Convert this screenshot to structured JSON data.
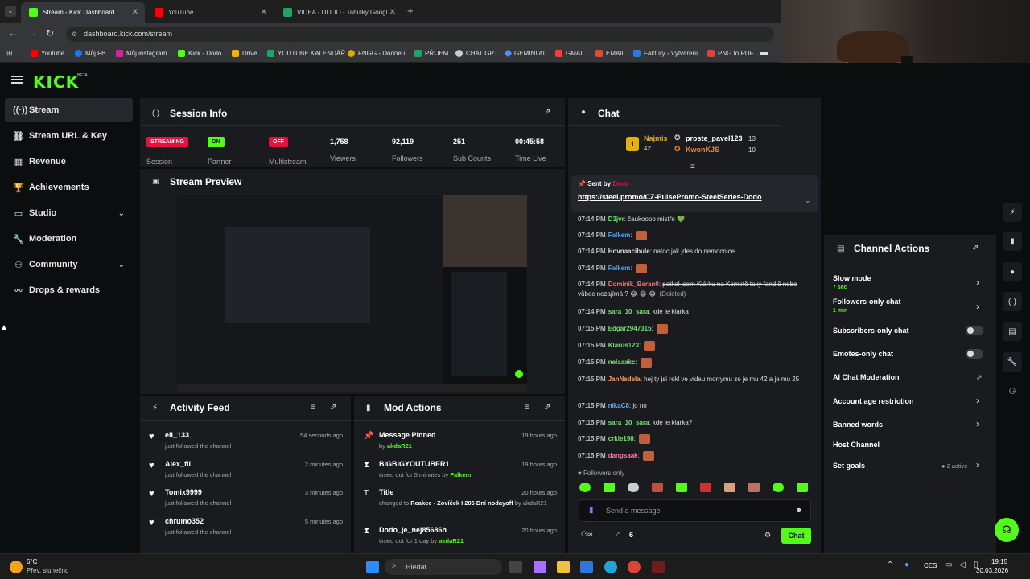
{
  "browser": {
    "tabs": [
      {
        "label": "Stream - Kick Dashboard",
        "color": "#53fc18"
      },
      {
        "label": "YouTube",
        "color": "#ff0000"
      },
      {
        "label": "VIDEA - DODO - Tabulky Googl...",
        "color": "#1fa463"
      }
    ],
    "url": "dashboard.kick.com/stream",
    "bookmarks": [
      {
        "label": "Youtube",
        "color": "#ff0000"
      },
      {
        "label": "Můj FB",
        "color": "#1877f2"
      },
      {
        "label": "Můj instagram",
        "color": "#d6249f"
      },
      {
        "label": "Kick - Dodo",
        "color": "#53fc18"
      },
      {
        "label": "Drive",
        "color": "#f4b400"
      },
      {
        "label": "YOUTUBE KALENDÁŘ",
        "color": "#1fa463"
      },
      {
        "label": "FNGG - Dodoeu",
        "color": "#e0a800"
      },
      {
        "label": "PŘÍJEM",
        "color": "#1fa463"
      },
      {
        "label": "CHAT GPT",
        "color": "#cccccc"
      },
      {
        "label": "GEMINI AI",
        "color": "#4f8cff"
      },
      {
        "label": "GMAIL",
        "color": "#ea4335"
      },
      {
        "label": "EMAIL",
        "color": "#e14b2c"
      },
      {
        "label": "Faktury - Vytváření",
        "color": "#2b79d8"
      },
      {
        "label": "PNG to PDF",
        "color": "#e0413a"
      }
    ]
  },
  "app": {
    "logo": "KICK",
    "logo_badge": "BETA",
    "sidebar": [
      {
        "label": "Stream",
        "icon": "radio-icon"
      },
      {
        "label": "Stream URL & Key",
        "icon": "link-icon"
      },
      {
        "label": "Revenue",
        "icon": "revenue-icon"
      },
      {
        "label": "Achievements",
        "icon": "trophy-icon"
      },
      {
        "label": "Studio",
        "icon": "studio-icon"
      },
      {
        "label": "Moderation",
        "icon": "wrench-icon"
      },
      {
        "label": "Community",
        "icon": "community-icon"
      },
      {
        "label": "Drops & rewards",
        "icon": "gift-icon"
      }
    ],
    "session": {
      "title": "Session Info",
      "streaming_badge": "STREAMING",
      "session_label": "Session",
      "partner_badge": "ON",
      "partner_label": "Partner",
      "multistream_badge": "OFF",
      "multistream_label": "Multistream",
      "viewers": "1,758",
      "viewers_label": "Viewers",
      "followers": "92,119",
      "followers_label": "Followers",
      "subs": "251",
      "subs_label": "Sub Counts",
      "time": "00:45:58",
      "time_label": "Time Live"
    },
    "preview": {
      "title": "Stream Preview"
    },
    "activity": {
      "title": "Activity Feed",
      "items": [
        {
          "name": "eli_133",
          "sub": "just followed the channel",
          "time": "54 seconds ago"
        },
        {
          "name": "Alex_fil",
          "sub": "just followed the channel",
          "time": "2 minutes ago"
        },
        {
          "name": "Tomix9999",
          "sub": "just followed the channel",
          "time": "3 minutes ago"
        },
        {
          "name": "chrumo352",
          "sub": "just followed the channel",
          "time": "5 minutes ago"
        }
      ]
    },
    "mod": {
      "title": "Mod Actions",
      "items": [
        {
          "name": "Message Pinned",
          "pre": "by",
          "who": "akdaR21",
          "post": "",
          "time": "19 hours ago"
        },
        {
          "name": "BIGBIGYOUTUBER1",
          "pre": "timed out for 5 minutes by",
          "who": "Falkem",
          "post": "",
          "time": "19 hours ago"
        },
        {
          "name": "Title",
          "pre": "changed to",
          "who": "Reakce - Zovíček I 205 Dní nodayoff",
          "post": "by akdaR21",
          "time": "20 hours ago"
        },
        {
          "name": "Dodo_je_nej85686h",
          "pre": "timed out for 1 day by",
          "who": "akdaR21",
          "post": "",
          "time": "20 hours ago"
        }
      ]
    },
    "chat": {
      "title": "Chat",
      "leader_1": "Najmis",
      "leader_1_count": "42",
      "leader_2": "proste_pavel123",
      "leader_2_count": "13",
      "leader_3": "KwonKJS",
      "leader_3_count": "10",
      "pinned_by": "Sent by",
      "pinned_user": "Dodo",
      "pinned_link": "https://steel.promo/CZ-PulsePromo-SteelSeries-Dodo",
      "messages": [
        {
          "time": "07:14 PM",
          "user": "D3jvr",
          "color": "#6fe36f",
          "text": "čaukoooo mistře 💚"
        },
        {
          "time": "07:14 PM",
          "user": "Falkem",
          "color": "#4aa8ff",
          "text": ""
        },
        {
          "time": "07:14 PM",
          "user": "Hovnaacibule",
          "color": "#dddddd",
          "text": "natoc jak jdes do nemocnice"
        },
        {
          "time": "07:14 PM",
          "user": "Falkem",
          "color": "#4aa8ff",
          "text": ""
        },
        {
          "time": "07:14 PM",
          "user": "Dominik_Beran0",
          "color": "#ff6b6b",
          "text": "potkal jsem Klárku na Kometě taky fandíš nebo vůbec nezajímá ? 😂 😂 😂",
          "deleted": "(Deleted)"
        },
        {
          "time": "07:14 PM",
          "user": "sara_10_sara",
          "color": "#6fe36f",
          "text": "kde je klarka"
        },
        {
          "time": "07:15 PM",
          "user": "Edgar2947315",
          "color": "#6fe36f",
          "text": ""
        },
        {
          "time": "07:15 PM",
          "user": "Klarus123",
          "color": "#6fe36f",
          "text": ""
        },
        {
          "time": "07:15 PM",
          "user": "nelaaakc",
          "color": "#6fe36f",
          "text": ""
        },
        {
          "time": "07:15 PM",
          "user": "JanNedela",
          "color": "#ff9a5c",
          "text": "hej ty jsi rekl ve videu morrymu ze je mu 42 a je mu 25"
        },
        {
          "time": "07:15 PM",
          "user": "nikaC8",
          "color": "#6aa9ff",
          "text": "jo no"
        },
        {
          "time": "07:15 PM",
          "user": "sara_10_sara",
          "color": "#6fe36f",
          "text": "kde je klarka?"
        },
        {
          "time": "07:15 PM",
          "user": "crkie198",
          "color": "#6fe36f",
          "text": ""
        },
        {
          "time": "07:15 PM",
          "user": "dangsaak",
          "color": "#ff7aa8",
          "text": ""
        }
      ],
      "followers_only": "Followers only",
      "placeholder": "Send a message",
      "count": "6",
      "send": "Chat"
    },
    "channel_actions": {
      "title": "Channel Actions",
      "slow_mode": "Slow mode",
      "slow_mode_sub": "7 sec",
      "followers_only": "Followers-only chat",
      "followers_only_sub": "1 min",
      "subs_only": "Subscribers-only chat",
      "emotes_only": "Emotes-only chat",
      "ai_mod": "AI Chat Moderation",
      "age": "Account age restriction",
      "banned": "Banned words",
      "host": "Host Channel",
      "goals": "Set goals",
      "goals_sub": "2 active"
    }
  },
  "taskbar": {
    "weather_temp": "6°C",
    "weather_text": "Přev. slunečno",
    "search": "Hledat",
    "lang": "CES",
    "time": "19:15",
    "date": "30.03.2026"
  }
}
